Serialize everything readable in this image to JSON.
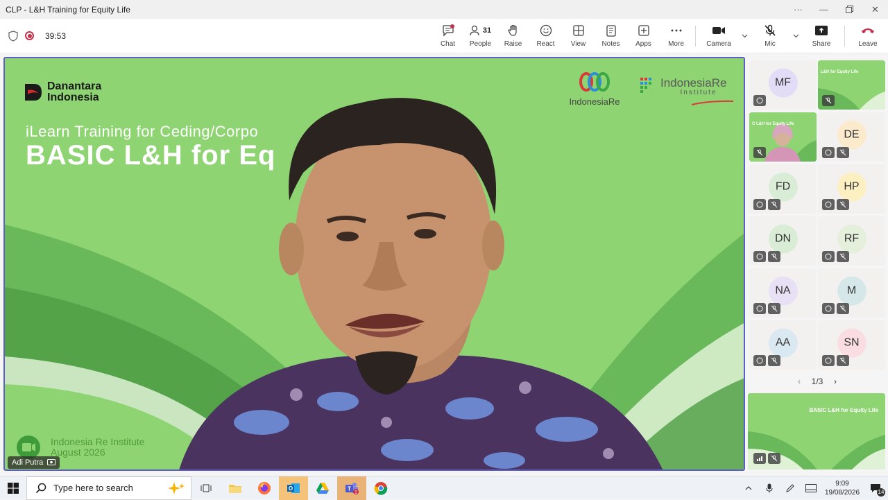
{
  "window": {
    "title": "CLP - L&H Training for Equity Life",
    "controls": [
      "more",
      "minimize",
      "restore",
      "close"
    ]
  },
  "meeting": {
    "timer": "39:53",
    "toolbar": [
      {
        "id": "chat",
        "label": "Chat",
        "icon": "chat-icon"
      },
      {
        "id": "people",
        "label": "People",
        "icon": "people-icon",
        "count": "31"
      },
      {
        "id": "raise",
        "label": "Raise",
        "icon": "hand-icon"
      },
      {
        "id": "react",
        "label": "React",
        "icon": "smiley-icon"
      },
      {
        "id": "view",
        "label": "View",
        "icon": "grid-icon"
      },
      {
        "id": "notes",
        "label": "Notes",
        "icon": "notes-icon"
      },
      {
        "id": "apps",
        "label": "Apps",
        "icon": "plus-box-icon"
      },
      {
        "id": "more",
        "label": "More",
        "icon": "ellipsis-icon"
      },
      {
        "id": "camera",
        "label": "Camera",
        "icon": "camera-icon"
      },
      {
        "id": "mic",
        "label": "Mic",
        "icon": "mic-off-icon"
      },
      {
        "id": "share",
        "label": "Share",
        "icon": "share-icon"
      },
      {
        "id": "leave",
        "label": "Leave",
        "icon": "phone-hangup-icon"
      }
    ]
  },
  "stage": {
    "brand": {
      "line1": "Danantara",
      "line2": "Indonesia"
    },
    "slide_subtitle": "iLearn Training for Ceding/Corpo",
    "slide_title": "BASIC L&H for Eq",
    "logo_indonesiare": "IndonesiaRe",
    "logo_iri_line1": "IndonesiaRe",
    "logo_iri_line2": "Institute",
    "footer_line1": "Indonesia Re Institute",
    "footer_line2": "August 2026",
    "speaker_name": "Adi Putra"
  },
  "gallery": {
    "tiles": [
      {
        "initials": "MF",
        "color": "#e3dcf7",
        "type": "avatar"
      },
      {
        "initials": "",
        "type": "video-slide",
        "mini": "L&H for Equity Life"
      },
      {
        "initials": "",
        "type": "video-person",
        "mini": "C L&H for Equity Life"
      },
      {
        "initials": "DE",
        "color": "#fbeacb",
        "type": "avatar"
      },
      {
        "initials": "FD",
        "color": "#d8ecd6",
        "type": "avatar"
      },
      {
        "initials": "HP",
        "color": "#fcefc2",
        "type": "avatar"
      },
      {
        "initials": "DN",
        "color": "#d8ecd6",
        "type": "avatar"
      },
      {
        "initials": "RF",
        "color": "#e4efdc",
        "type": "avatar"
      },
      {
        "initials": "NA",
        "color": "#e8e1f5",
        "type": "avatar"
      },
      {
        "initials": "M",
        "color": "#d6e7ea",
        "type": "avatar"
      },
      {
        "initials": "AA",
        "color": "#dae8f2",
        "type": "avatar"
      },
      {
        "initials": "SN",
        "color": "#f9dde2",
        "type": "avatar"
      }
    ],
    "pager": "1/3",
    "share_mini_title": "BASIC L&H for Equity Life"
  },
  "taskbar": {
    "search_placeholder": "Type here to search",
    "time": "9:09",
    "date": "19/08/2026",
    "notification_count": "14"
  }
}
